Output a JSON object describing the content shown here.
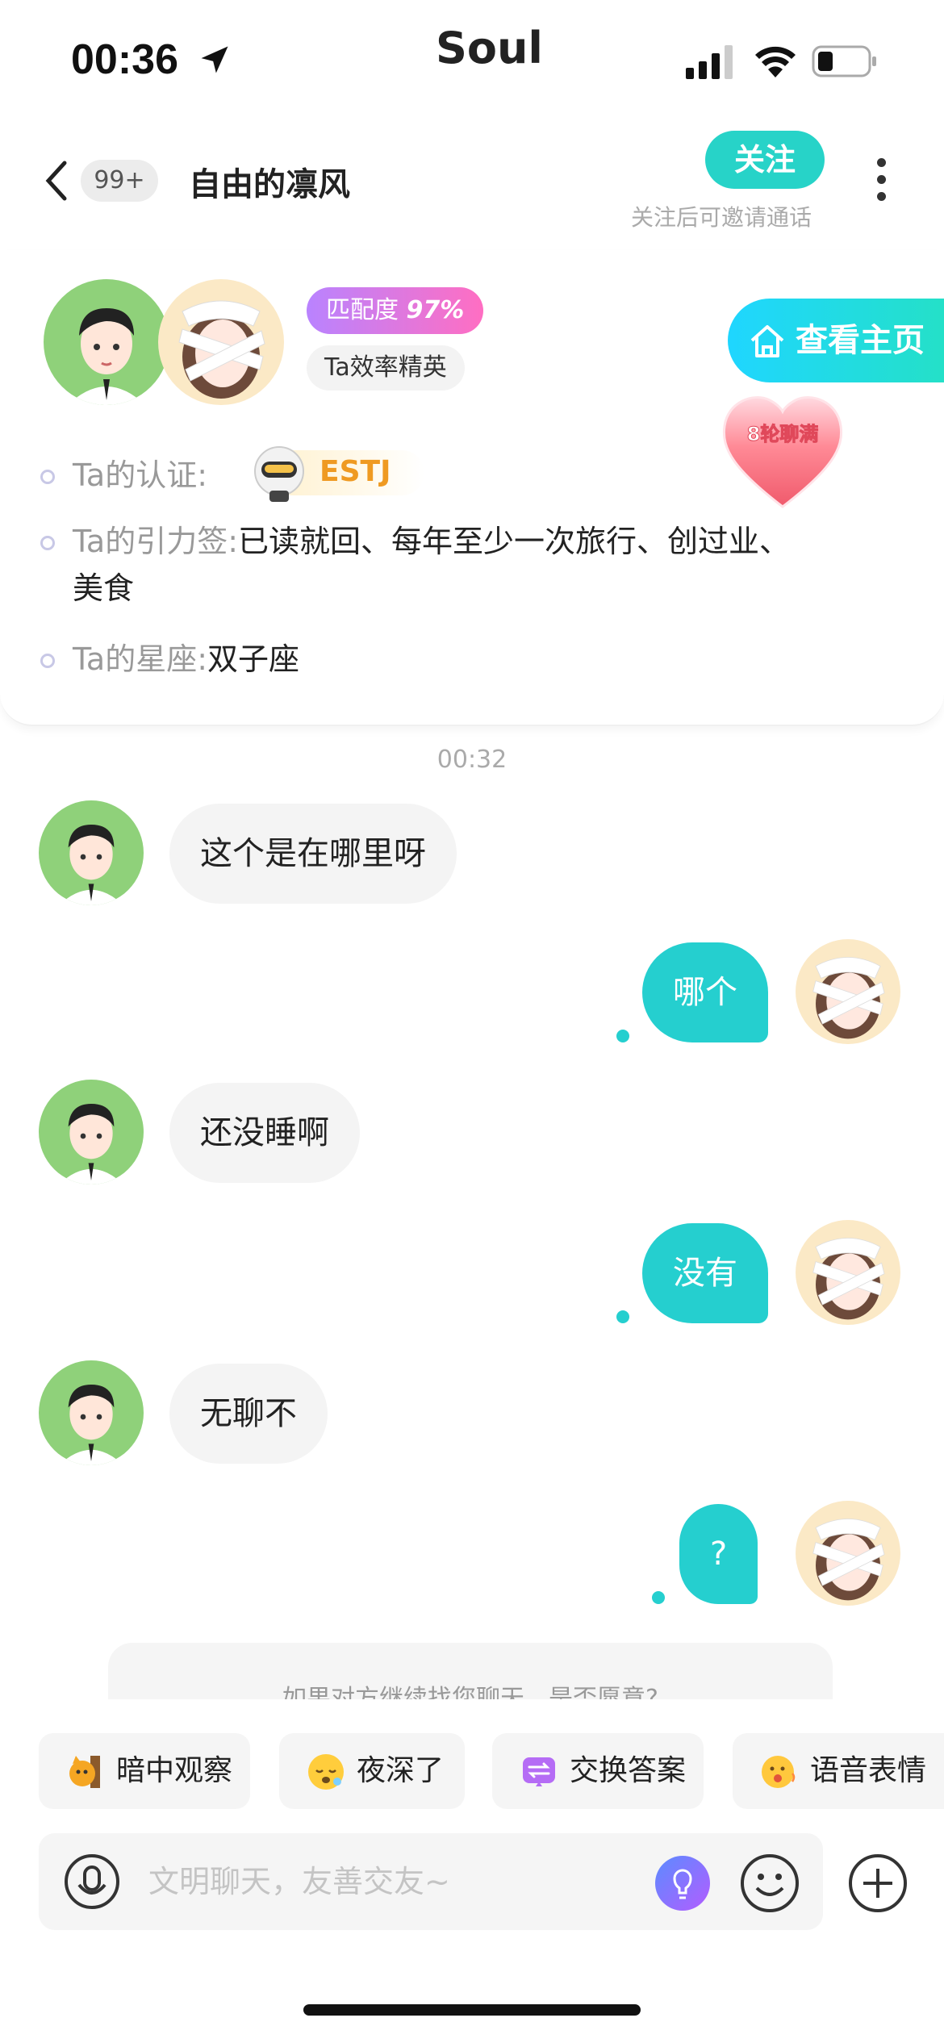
{
  "status_bar": {
    "time": "00:36",
    "brand": "Soul"
  },
  "header": {
    "unread_count": "99+",
    "title": "自由的凛风",
    "follow_label": "关注",
    "follow_hint": "关注后可邀请通话"
  },
  "profile": {
    "match_label": "匹配度",
    "match_value": "97%",
    "elite_tag": "Ta效率精英",
    "homepage_label": "查看主页",
    "heart_badge": "8轮聊满",
    "cert_label": "Ta的认证:",
    "cert_value": "ESTJ",
    "tags_label": "Ta的引力签:",
    "tags_line1": "已读就回、每年至少一次旅行、创过业、",
    "tags_line2": "美食",
    "zodiac_label": "Ta的星座:",
    "zodiac_value": "双子座"
  },
  "chat": {
    "timestamp": "00:32",
    "messages": [
      {
        "from": "them",
        "text": "这个是在哪里呀"
      },
      {
        "from": "me",
        "text": "哪个"
      },
      {
        "from": "them",
        "text": "还没睡啊"
      },
      {
        "from": "me",
        "text": "没有"
      },
      {
        "from": "them",
        "text": "无聊不"
      },
      {
        "from": "me",
        "text": "?"
      }
    ],
    "prompt_text": "如果对方继续找您聊天，是否愿意?"
  },
  "quick_chips": [
    {
      "label": "暗中观察",
      "icon": "peek-cat-icon"
    },
    {
      "label": "夜深了",
      "icon": "sleepy-face-icon"
    },
    {
      "label": "交换答案",
      "icon": "exchange-icon"
    },
    {
      "label": "语音表情",
      "icon": "voice-emoji-icon"
    }
  ],
  "input": {
    "placeholder": "文明聊天，友善交友~"
  },
  "colors": {
    "accent": "#25cfcf",
    "match_gradient_start": "#b983ff",
    "match_gradient_end": "#ff6ec2"
  }
}
